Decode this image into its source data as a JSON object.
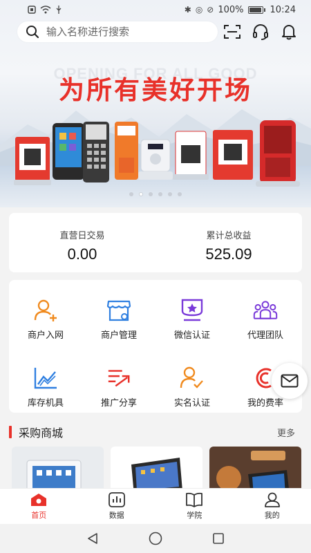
{
  "status_bar": {
    "time": "10:24",
    "battery": "100%",
    "battery_level": 1.0
  },
  "header": {
    "search_placeholder": "输入名称进行搜索",
    "icons": [
      "scan-icon",
      "headset-icon",
      "bell-icon"
    ]
  },
  "banner": {
    "english_text": "OPENING FOR ALL GOOD",
    "title": "为所有美好开场",
    "slide_count": 6,
    "active_slide": 2
  },
  "stats": [
    {
      "label": "直营日交易",
      "value": "0.00"
    },
    {
      "label": "累计总收益",
      "value": "525.09"
    }
  ],
  "menu": [
    {
      "label": "商户入网",
      "icon": "add-user-icon",
      "color": "#f08a1e"
    },
    {
      "label": "商户管理",
      "icon": "store-icon",
      "color": "#2f7fe0"
    },
    {
      "label": "微信认证",
      "icon": "award-icon",
      "color": "#7a3ad9"
    },
    {
      "label": "代理团队",
      "icon": "team-icon",
      "color": "#7a3ad9"
    },
    {
      "label": "库存机具",
      "icon": "chart-trend-icon",
      "color": "#2f7fe0"
    },
    {
      "label": "推广分享",
      "icon": "share-arrow-icon",
      "color": "#e8312a"
    },
    {
      "label": "实名认证",
      "icon": "user-verified-icon",
      "color": "#f08a1e"
    },
    {
      "label": "我的费率",
      "icon": "rate-icon",
      "color": "#e8312a"
    }
  ],
  "shop": {
    "title": "采购商城",
    "more": "更多"
  },
  "tabs": [
    {
      "label": "首页",
      "icon": "home-icon",
      "active": true
    },
    {
      "label": "数据",
      "icon": "data-icon",
      "active": false
    },
    {
      "label": "学院",
      "icon": "book-icon",
      "active": false
    },
    {
      "label": "我的",
      "icon": "profile-icon",
      "active": false
    }
  ],
  "colors": {
    "accent": "#e8312a",
    "blue": "#2f7fe0",
    "orange": "#f08a1e",
    "purple": "#7a3ad9"
  }
}
